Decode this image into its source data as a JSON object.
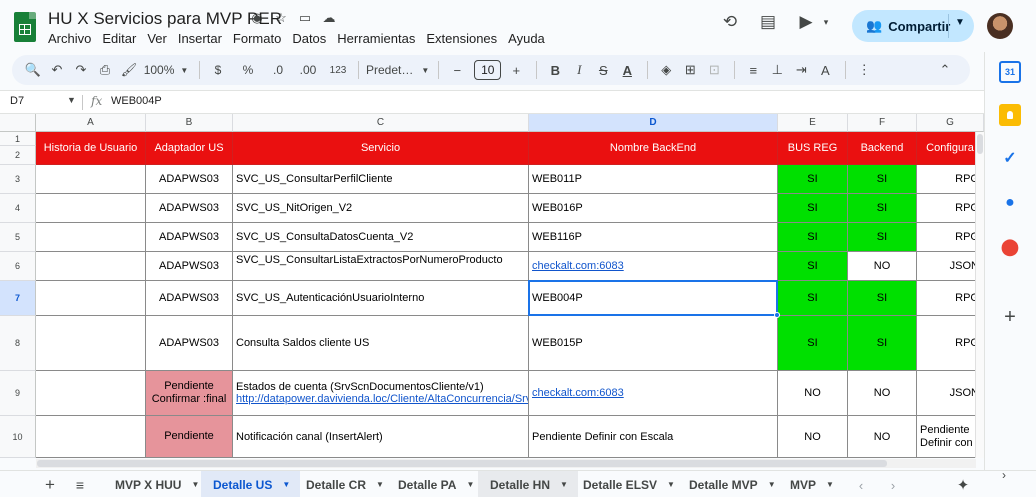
{
  "app": {
    "doc_title": "HU X Servicios para MVP PER",
    "menu": [
      "Archivo",
      "Editar",
      "Ver",
      "Insertar",
      "Formato",
      "Datos",
      "Herramientas",
      "Extensiones",
      "Ayuda"
    ],
    "share_label": "Compartir"
  },
  "toolbar": {
    "zoom": "100%",
    "currency": "$",
    "percent": "%",
    "dec_decrease": ".0",
    "dec_increase": ".00",
    "number_format": "123",
    "font": "Predet…",
    "font_size": "10",
    "minus": "−",
    "plus": "+"
  },
  "formula_bar": {
    "cell_ref": "D7",
    "fx": "fx",
    "value": "WEB004P"
  },
  "columns": [
    "A",
    "B",
    "C",
    "D",
    "E",
    "F",
    "G"
  ],
  "header_row": {
    "A": "Historia de Usuario",
    "B": "Adaptador US",
    "C": "Servicio",
    "D": "Nombre BackEnd",
    "E": "BUS REG",
    "F": "Backend",
    "G": "Configura"
  },
  "rows": [
    {
      "num": "3",
      "A": "",
      "B": "ADAPWS03",
      "C": "SVC_US_ConsultarPerfilCliente",
      "D": "WEB011P",
      "E": "SI",
      "F": "SI",
      "G": "RPG"
    },
    {
      "num": "4",
      "A": "",
      "B": "ADAPWS03",
      "C": "SVC_US_NitOrigen_V2",
      "D": "WEB016P",
      "E": "SI",
      "F": "SI",
      "G": "RPG"
    },
    {
      "num": "5",
      "A": "",
      "B": "ADAPWS03",
      "C": "SVC_US_ConsultaDatosCuenta_V2",
      "D": "WEB116P",
      "E": "SI",
      "F": "SI",
      "G": "RPG"
    },
    {
      "num": "6",
      "A": "",
      "B": "ADAPWS03",
      "C": "SVC_US_ConsultarListaExtractosPorNumeroProducto",
      "D": "checkalt.com:6083",
      "E": "SI",
      "F": "NO",
      "G": "JSON"
    },
    {
      "num": "7",
      "A": "",
      "B": "ADAPWS03",
      "C": "SVC_US_AutenticaciónUsuarioInterno",
      "D": "WEB004P",
      "E": "SI",
      "F": "SI",
      "G": "RPG"
    },
    {
      "num": "8",
      "A": "",
      "B": "ADAPWS03",
      "C": "Consulta Saldos cliente US",
      "D": "WEB015P",
      "E": "SI",
      "F": "SI",
      "G": "RPG"
    },
    {
      "num": "9",
      "A": "",
      "B": "Pendiente Confirmar :final",
      "C": "Estados de cuenta (SrvScnDocumentosCliente/v1)",
      "C_link": "http://datapower.davivienda.loc/Cliente/AltaConcurrencia/SrvSc",
      "D": "checkalt.com:6083",
      "E": "NO",
      "F": "NO",
      "G": "JSON"
    },
    {
      "num": "10",
      "A": "",
      "B": "Pendiente",
      "C": "Notificación canal (InsertAlert)",
      "D": "Pendiente Definir con Escala",
      "E": "NO",
      "F": "NO",
      "G": "Pendiente Definir con"
    }
  ],
  "row_header_labels": [
    "1",
    "2"
  ],
  "sheet_tabs": [
    "MVP X HUU",
    "Detalle US",
    "Detalle CR",
    "Detalle PA",
    "Detalle HN",
    "Detalle ELSV",
    "Detalle MVP",
    "MVP"
  ],
  "active_tab": "Detalle US",
  "side_panel": {
    "calendar_day": "31"
  },
  "colors": {
    "header_red": "#ea1010",
    "si_green": "#00e000",
    "pending_pink": "#e6949b",
    "selection_blue": "#1a73e8"
  }
}
